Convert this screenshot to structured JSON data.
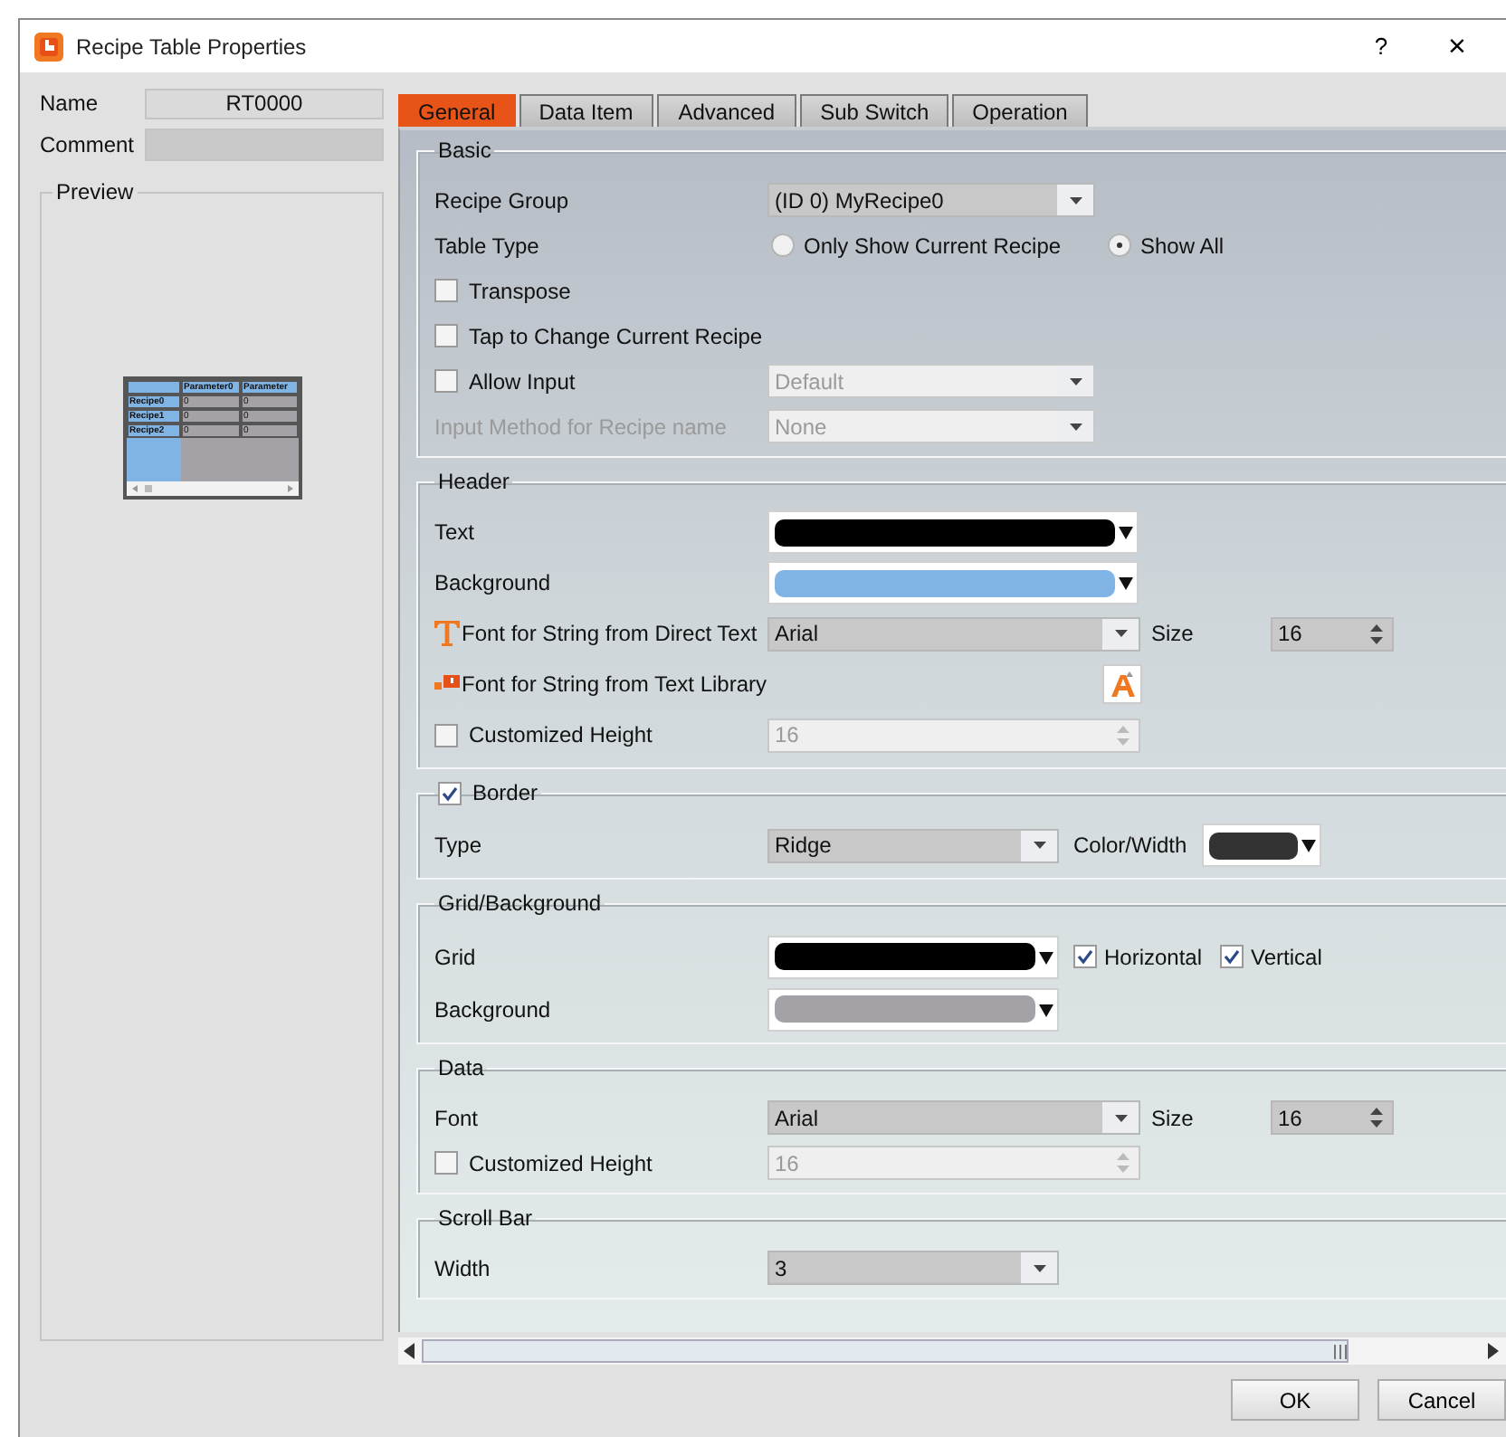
{
  "window": {
    "title": "Recipe Table Properties",
    "help": "?",
    "close": "×"
  },
  "left": {
    "name_label": "Name",
    "name_value": "RT0000",
    "comment_label": "Comment",
    "preview_label": "Preview",
    "preview": {
      "columns": [
        "Parameter0",
        "Parameter"
      ],
      "rows": [
        {
          "name": "Recipe0",
          "cells": [
            "0",
            "0"
          ]
        },
        {
          "name": "Recipe1",
          "cells": [
            "0",
            "0"
          ]
        },
        {
          "name": "Recipe2",
          "cells": [
            "0",
            "0"
          ]
        }
      ]
    }
  },
  "tabs": [
    {
      "label": "General",
      "selected": true
    },
    {
      "label": "Data Item",
      "selected": false
    },
    {
      "label": "Advanced",
      "selected": false
    },
    {
      "label": "Sub Switch",
      "selected": false
    },
    {
      "label": "Operation",
      "selected": false
    }
  ],
  "sections": [
    {
      "title": "Basic",
      "rows": [
        {
          "kind": "field",
          "label": "Recipe Group",
          "control": {
            "kind": "select",
            "value": "(ID 0) MyRecipe0",
            "disabled": false
          }
        },
        {
          "kind": "field",
          "label": "Table Type",
          "control": {
            "kind": "radios",
            "options": [
              {
                "label": "Only Show Current Recipe",
                "selected": false
              },
              {
                "label": "Show All",
                "selected": true
              }
            ]
          }
        },
        {
          "kind": "check",
          "label": "Transpose",
          "checked": false
        },
        {
          "kind": "check",
          "label": "Tap to Change Current Recipe",
          "checked": false
        },
        {
          "kind": "check",
          "label": "Allow Input",
          "checked": false,
          "control": {
            "kind": "select",
            "value": "Default",
            "disabled": true
          }
        },
        {
          "kind": "field",
          "label": "Input Method for Recipe name",
          "disabled": true,
          "control": {
            "kind": "select",
            "value": "None",
            "disabled": true
          }
        }
      ]
    },
    {
      "title": "Header",
      "rows": [
        {
          "kind": "field",
          "label": "Text",
          "control": {
            "kind": "color",
            "color": "#000000"
          }
        },
        {
          "kind": "field",
          "label": "Background",
          "control": {
            "kind": "color",
            "color": "#80b4e4"
          }
        },
        {
          "kind": "font-direct",
          "label": "Font for String from Direct Text",
          "control": {
            "kind": "select",
            "value": "Arial",
            "disabled": false
          },
          "size": {
            "label": "Size",
            "value": "16"
          }
        },
        {
          "kind": "font-library",
          "label": "Font for String from Text Library",
          "control": {
            "kind": "font-button"
          }
        },
        {
          "kind": "check",
          "label": "Customized Height",
          "checked": false,
          "control": {
            "kind": "spin",
            "value": "16",
            "disabled": true
          }
        }
      ]
    },
    {
      "title": "Border",
      "checked": true,
      "rows": [
        {
          "kind": "field",
          "label": "Type",
          "control": {
            "kind": "select",
            "value": "Ridge",
            "disabled": false
          },
          "extra": {
            "label": "Color/Width",
            "color": "#333333"
          }
        }
      ]
    },
    {
      "title": "Grid/Background",
      "rows": [
        {
          "kind": "field",
          "label": "Grid",
          "control": {
            "kind": "color",
            "color": "#000000"
          },
          "checks": [
            {
              "label": "Horizontal",
              "checked": true
            },
            {
              "label": "Vertical",
              "checked": true
            }
          ]
        },
        {
          "kind": "field",
          "label": "Background",
          "control": {
            "kind": "color",
            "color": "#a4a2a6"
          }
        }
      ]
    },
    {
      "title": "Data",
      "rows": [
        {
          "kind": "field",
          "label": "Font",
          "control": {
            "kind": "select",
            "value": "Arial",
            "disabled": false
          },
          "size": {
            "label": "Size",
            "value": "16"
          }
        },
        {
          "kind": "check",
          "label": "Customized Height",
          "checked": false,
          "control": {
            "kind": "spin",
            "value": "16",
            "disabled": true
          }
        }
      ]
    },
    {
      "title": "Scroll Bar",
      "rows": [
        {
          "kind": "field",
          "label": "Width",
          "control": {
            "kind": "select",
            "value": "3",
            "disabled": false
          }
        }
      ]
    }
  ],
  "buttons": [
    {
      "label": "OK"
    },
    {
      "label": "Cancel"
    }
  ]
}
